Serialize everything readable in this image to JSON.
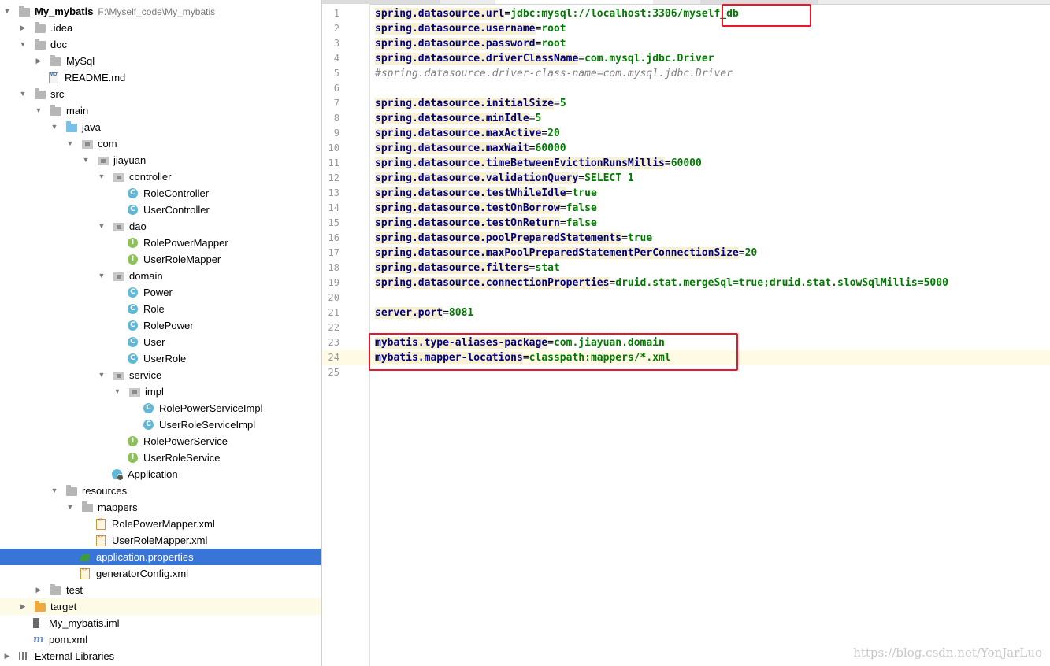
{
  "project": {
    "name": "My_mybatis",
    "path": "F:\\Myself_code\\My_mybatis"
  },
  "tree": [
    {
      "label": "My_mybatis",
      "path": "F:\\Myself_code\\My_mybatis",
      "depth": 0,
      "arrow": "down",
      "icon": "folder",
      "bold": true
    },
    {
      "label": ".idea",
      "depth": 1,
      "arrow": "right",
      "icon": "folder"
    },
    {
      "label": "doc",
      "depth": 1,
      "arrow": "down",
      "icon": "folder"
    },
    {
      "label": "MySql",
      "depth": 2,
      "arrow": "right",
      "icon": "folder"
    },
    {
      "label": "README.md",
      "depth": 2,
      "arrow": "none",
      "icon": "markdown-file"
    },
    {
      "label": "src",
      "depth": 1,
      "arrow": "down",
      "icon": "folder"
    },
    {
      "label": "main",
      "depth": 2,
      "arrow": "down",
      "icon": "folder"
    },
    {
      "label": "java",
      "depth": 3,
      "arrow": "down",
      "icon": "source-folder"
    },
    {
      "label": "com",
      "depth": 4,
      "arrow": "down",
      "icon": "package"
    },
    {
      "label": "jiayuan",
      "depth": 5,
      "arrow": "down",
      "icon": "package"
    },
    {
      "label": "controller",
      "depth": 6,
      "arrow": "down",
      "icon": "package"
    },
    {
      "label": "RoleController",
      "depth": 7,
      "arrow": "none",
      "icon": "class"
    },
    {
      "label": "UserController",
      "depth": 7,
      "arrow": "none",
      "icon": "class"
    },
    {
      "label": "dao",
      "depth": 6,
      "arrow": "down",
      "icon": "package"
    },
    {
      "label": "RolePowerMapper",
      "depth": 7,
      "arrow": "none",
      "icon": "interface"
    },
    {
      "label": "UserRoleMapper",
      "depth": 7,
      "arrow": "none",
      "icon": "interface"
    },
    {
      "label": "domain",
      "depth": 6,
      "arrow": "down",
      "icon": "package"
    },
    {
      "label": "Power",
      "depth": 7,
      "arrow": "none",
      "icon": "class"
    },
    {
      "label": "Role",
      "depth": 7,
      "arrow": "none",
      "icon": "class"
    },
    {
      "label": "RolePower",
      "depth": 7,
      "arrow": "none",
      "icon": "class"
    },
    {
      "label": "User",
      "depth": 7,
      "arrow": "none",
      "icon": "class"
    },
    {
      "label": "UserRole",
      "depth": 7,
      "arrow": "none",
      "icon": "class"
    },
    {
      "label": "service",
      "depth": 6,
      "arrow": "down",
      "icon": "package"
    },
    {
      "label": "impl",
      "depth": 7,
      "arrow": "down",
      "icon": "package"
    },
    {
      "label": "RolePowerServiceImpl",
      "depth": 8,
      "arrow": "none",
      "icon": "class"
    },
    {
      "label": "UserRoleServiceImpl",
      "depth": 8,
      "arrow": "none",
      "icon": "class"
    },
    {
      "label": "RolePowerService",
      "depth": 7,
      "arrow": "none",
      "icon": "interface"
    },
    {
      "label": "UserRoleService",
      "depth": 7,
      "arrow": "none",
      "icon": "interface"
    },
    {
      "label": "Application",
      "depth": 6,
      "arrow": "none",
      "icon": "spring-app"
    },
    {
      "label": "resources",
      "depth": 3,
      "arrow": "down",
      "icon": "resources-folder"
    },
    {
      "label": "mappers",
      "depth": 4,
      "arrow": "down",
      "icon": "folder"
    },
    {
      "label": "RolePowerMapper.xml",
      "depth": 5,
      "arrow": "none",
      "icon": "xml-file"
    },
    {
      "label": "UserRoleMapper.xml",
      "depth": 5,
      "arrow": "none",
      "icon": "xml-file"
    },
    {
      "label": "application.properties",
      "depth": 4,
      "arrow": "none",
      "icon": "spring-leaf",
      "selected": true
    },
    {
      "label": "generatorConfig.xml",
      "depth": 4,
      "arrow": "none",
      "icon": "xml-file"
    },
    {
      "label": "test",
      "depth": 2,
      "arrow": "right",
      "icon": "folder"
    },
    {
      "label": "target",
      "depth": 1,
      "arrow": "right",
      "icon": "excluded-folder",
      "highlighted": true
    },
    {
      "label": "My_mybatis.iml",
      "depth": 1,
      "arrow": "none",
      "icon": "iml-file"
    },
    {
      "label": "pom.xml",
      "depth": 1,
      "arrow": "none",
      "icon": "maven-file"
    },
    {
      "label": "External Libraries",
      "depth": 0,
      "arrow": "right",
      "icon": "libraries"
    }
  ],
  "editor": {
    "current_line": 24,
    "lines": [
      {
        "n": "1",
        "key": "spring.datasource.url",
        "value": "jdbc:mysql://localhost:3306/myself_db"
      },
      {
        "n": "2",
        "key": "spring.datasource.username",
        "value": "root"
      },
      {
        "n": "3",
        "key": "spring.datasource.password",
        "value": "root"
      },
      {
        "n": "4",
        "key": "spring.datasource.driverClassName",
        "value": "com.mysql.jdbc.Driver"
      },
      {
        "n": "5",
        "comment": "#spring.datasource.driver-class-name=com.mysql.jdbc.Driver"
      },
      {
        "n": "6"
      },
      {
        "n": "7",
        "key": "spring.datasource.initialSize",
        "value": "5"
      },
      {
        "n": "8",
        "key": "spring.datasource.minIdle",
        "value": "5"
      },
      {
        "n": "9",
        "key": "spring.datasource.maxActive",
        "value": "20"
      },
      {
        "n": "10",
        "key": "spring.datasource.maxWait",
        "value": "60000"
      },
      {
        "n": "11",
        "key": "spring.datasource.timeBetweenEvictionRunsMillis",
        "value": "60000"
      },
      {
        "n": "12",
        "key": "spring.datasource.validationQuery",
        "value": "SELECT 1"
      },
      {
        "n": "13",
        "key": "spring.datasource.testWhileIdle",
        "value": "true"
      },
      {
        "n": "14",
        "key": "spring.datasource.testOnBorrow",
        "value": "false"
      },
      {
        "n": "15",
        "key": "spring.datasource.testOnReturn",
        "value": "false"
      },
      {
        "n": "16",
        "key": "spring.datasource.poolPreparedStatements",
        "value": "true"
      },
      {
        "n": "17",
        "key": "spring.datasource.maxPoolPreparedStatementPerConnectionSize",
        "value": "20"
      },
      {
        "n": "18",
        "key": "spring.datasource.filters",
        "value": "stat"
      },
      {
        "n": "19",
        "key": "spring.datasource.connectionProperties",
        "value": "druid.stat.mergeSql=true;druid.stat.slowSqlMillis=5000"
      },
      {
        "n": "20"
      },
      {
        "n": "21",
        "key": "server.port",
        "value": "8081"
      },
      {
        "n": "22"
      },
      {
        "n": "23",
        "key": "mybatis.type-aliases-package",
        "value": "com.jiayuan.domain"
      },
      {
        "n": "24",
        "key": "mybatis.mapper-locations",
        "value": "classpath:mappers/*.xml"
      },
      {
        "n": "25"
      }
    ]
  },
  "watermark": "https://blog.csdn.net/YonJarLuo",
  "colors": {
    "selection": "#3875d7",
    "key": "#000080",
    "value": "#007b00",
    "comment": "#808080",
    "annotation_box": "#e8182a"
  }
}
